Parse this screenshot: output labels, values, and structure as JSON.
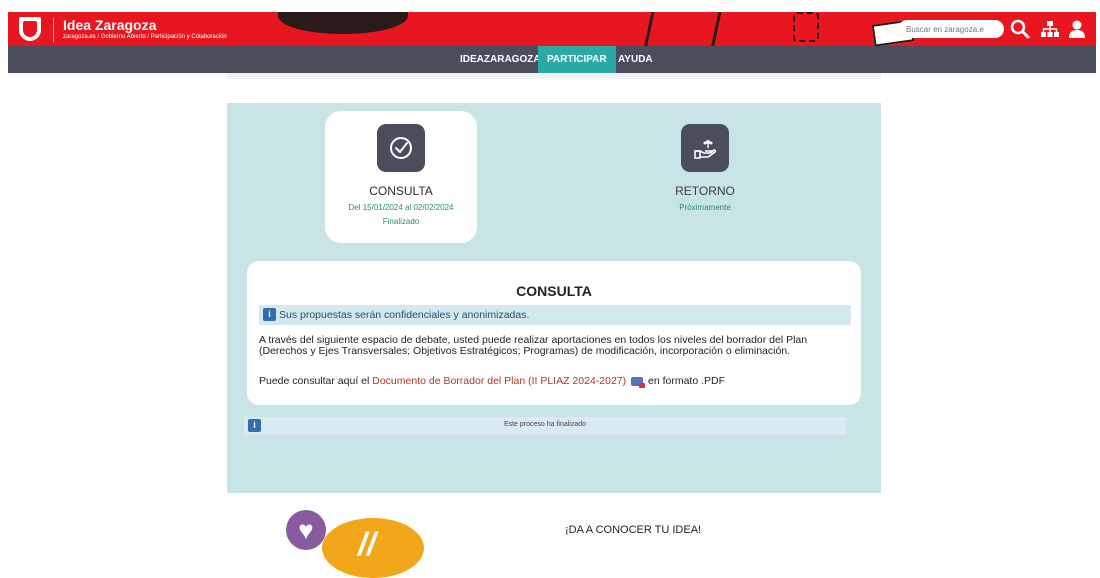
{
  "header": {
    "title": "Idea Zaragoza",
    "breadcrumbs": "zaragoza.es /  Gobierno Abierto /  Participación y Colaboración",
    "search_placeholder": "Buscar en zaragoza.e",
    "brand_color": "#e8171f"
  },
  "nav": {
    "items": [
      "IDEAZARAGOZA",
      "PARTICIPAR",
      "AYUDA"
    ],
    "active": "PARTICIPAR"
  },
  "phases": [
    {
      "title": "CONSULTA",
      "date": "Del 15/01/2024 al 02/02/2024",
      "status": "Finalizado",
      "icon": "check-circle-icon"
    },
    {
      "title": "RETORNO",
      "status": "Próximamente",
      "icon": "hand-sprout-icon"
    }
  ],
  "consulta": {
    "title": "CONSULTA",
    "notice": "Sus propuestas serán confidenciales y anonimizadas.",
    "body": "A través del siguiente espacio de debate, usted puede realizar aportaciones en todos los niveles del borrador del Plan (Derechos y Ejes Transversales; Objetivos Estratégicos; Programas) de modificación, incorporación o eliminación.",
    "doc_prefix": "Puede consultar aquí el ",
    "doc_link": "Documento de Borrador del Plan (II PLIAZ 2024-2027)",
    "doc_suffix": " en formato .PDF"
  },
  "finished_notice": "Este proceso ha finalizado",
  "promo": {
    "text": "¡DA A CONOCER TU IDEA!"
  },
  "colors": {
    "panel": "#c8e4e6",
    "nav": "#4a4d5c",
    "nav_active": "#2ba9a8",
    "link": "#b0362a",
    "status": "#2a8a73"
  }
}
